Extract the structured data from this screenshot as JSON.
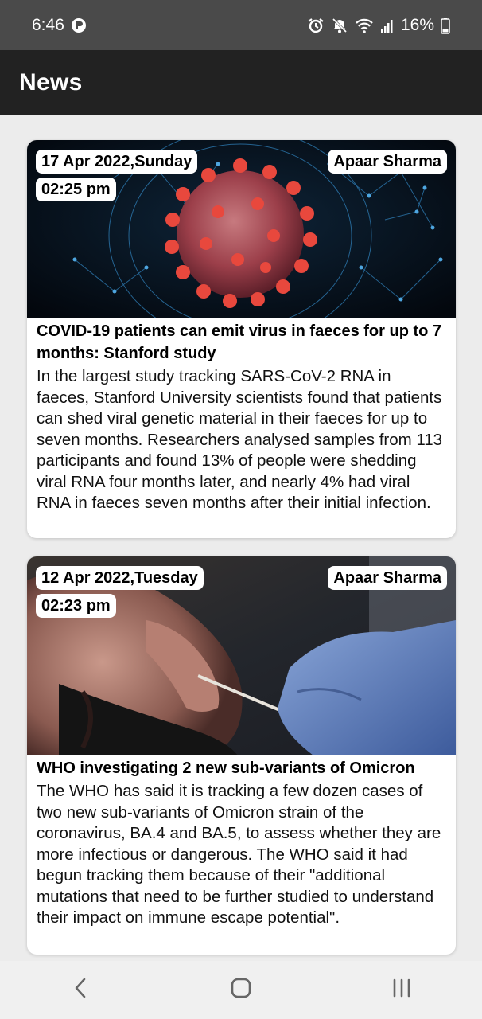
{
  "status_bar": {
    "time": "6:46",
    "battery": "16%"
  },
  "app_bar": {
    "title": "News"
  },
  "articles": [
    {
      "date": "17 Apr 2022,Sunday",
      "time": "02:25 pm",
      "author": "Apaar Sharma",
      "title": "COVID-19 patients can emit virus in faeces for up to 7 months: Stanford study",
      "body": "In the largest study tracking SARS-CoV-2 RNA in faeces, Stanford University scientists found that patients can shed viral genetic material in their faeces for up to seven months. Researchers analysed samples from 113 participants and found 13% of people were shedding viral RNA four months later, and nearly 4% had viral RNA in faeces seven months after their initial infection."
    },
    {
      "date": "12 Apr 2022,Tuesday",
      "time": "02:23 pm",
      "author": "Apaar Sharma",
      "title": "WHO investigating 2 new sub-variants of Omicron",
      "body": "The WHO has said it is tracking a few dozen cases of two new sub-variants of Omicron strain of the coronavirus, BA.4 and BA.5, to assess whether they are more infectious or dangerous. The WHO said it had begun tracking them because of their \"additional mutations that need to be further studied to understand their impact on immune escape potential\"."
    }
  ],
  "icons": {
    "status_left": "data-saver-icon",
    "status_right": [
      "alarm-icon",
      "mute-icon",
      "wifi-icon",
      "signal-icon",
      "battery-icon"
    ],
    "nav": [
      "back-icon",
      "home-icon",
      "recents-icon"
    ]
  }
}
